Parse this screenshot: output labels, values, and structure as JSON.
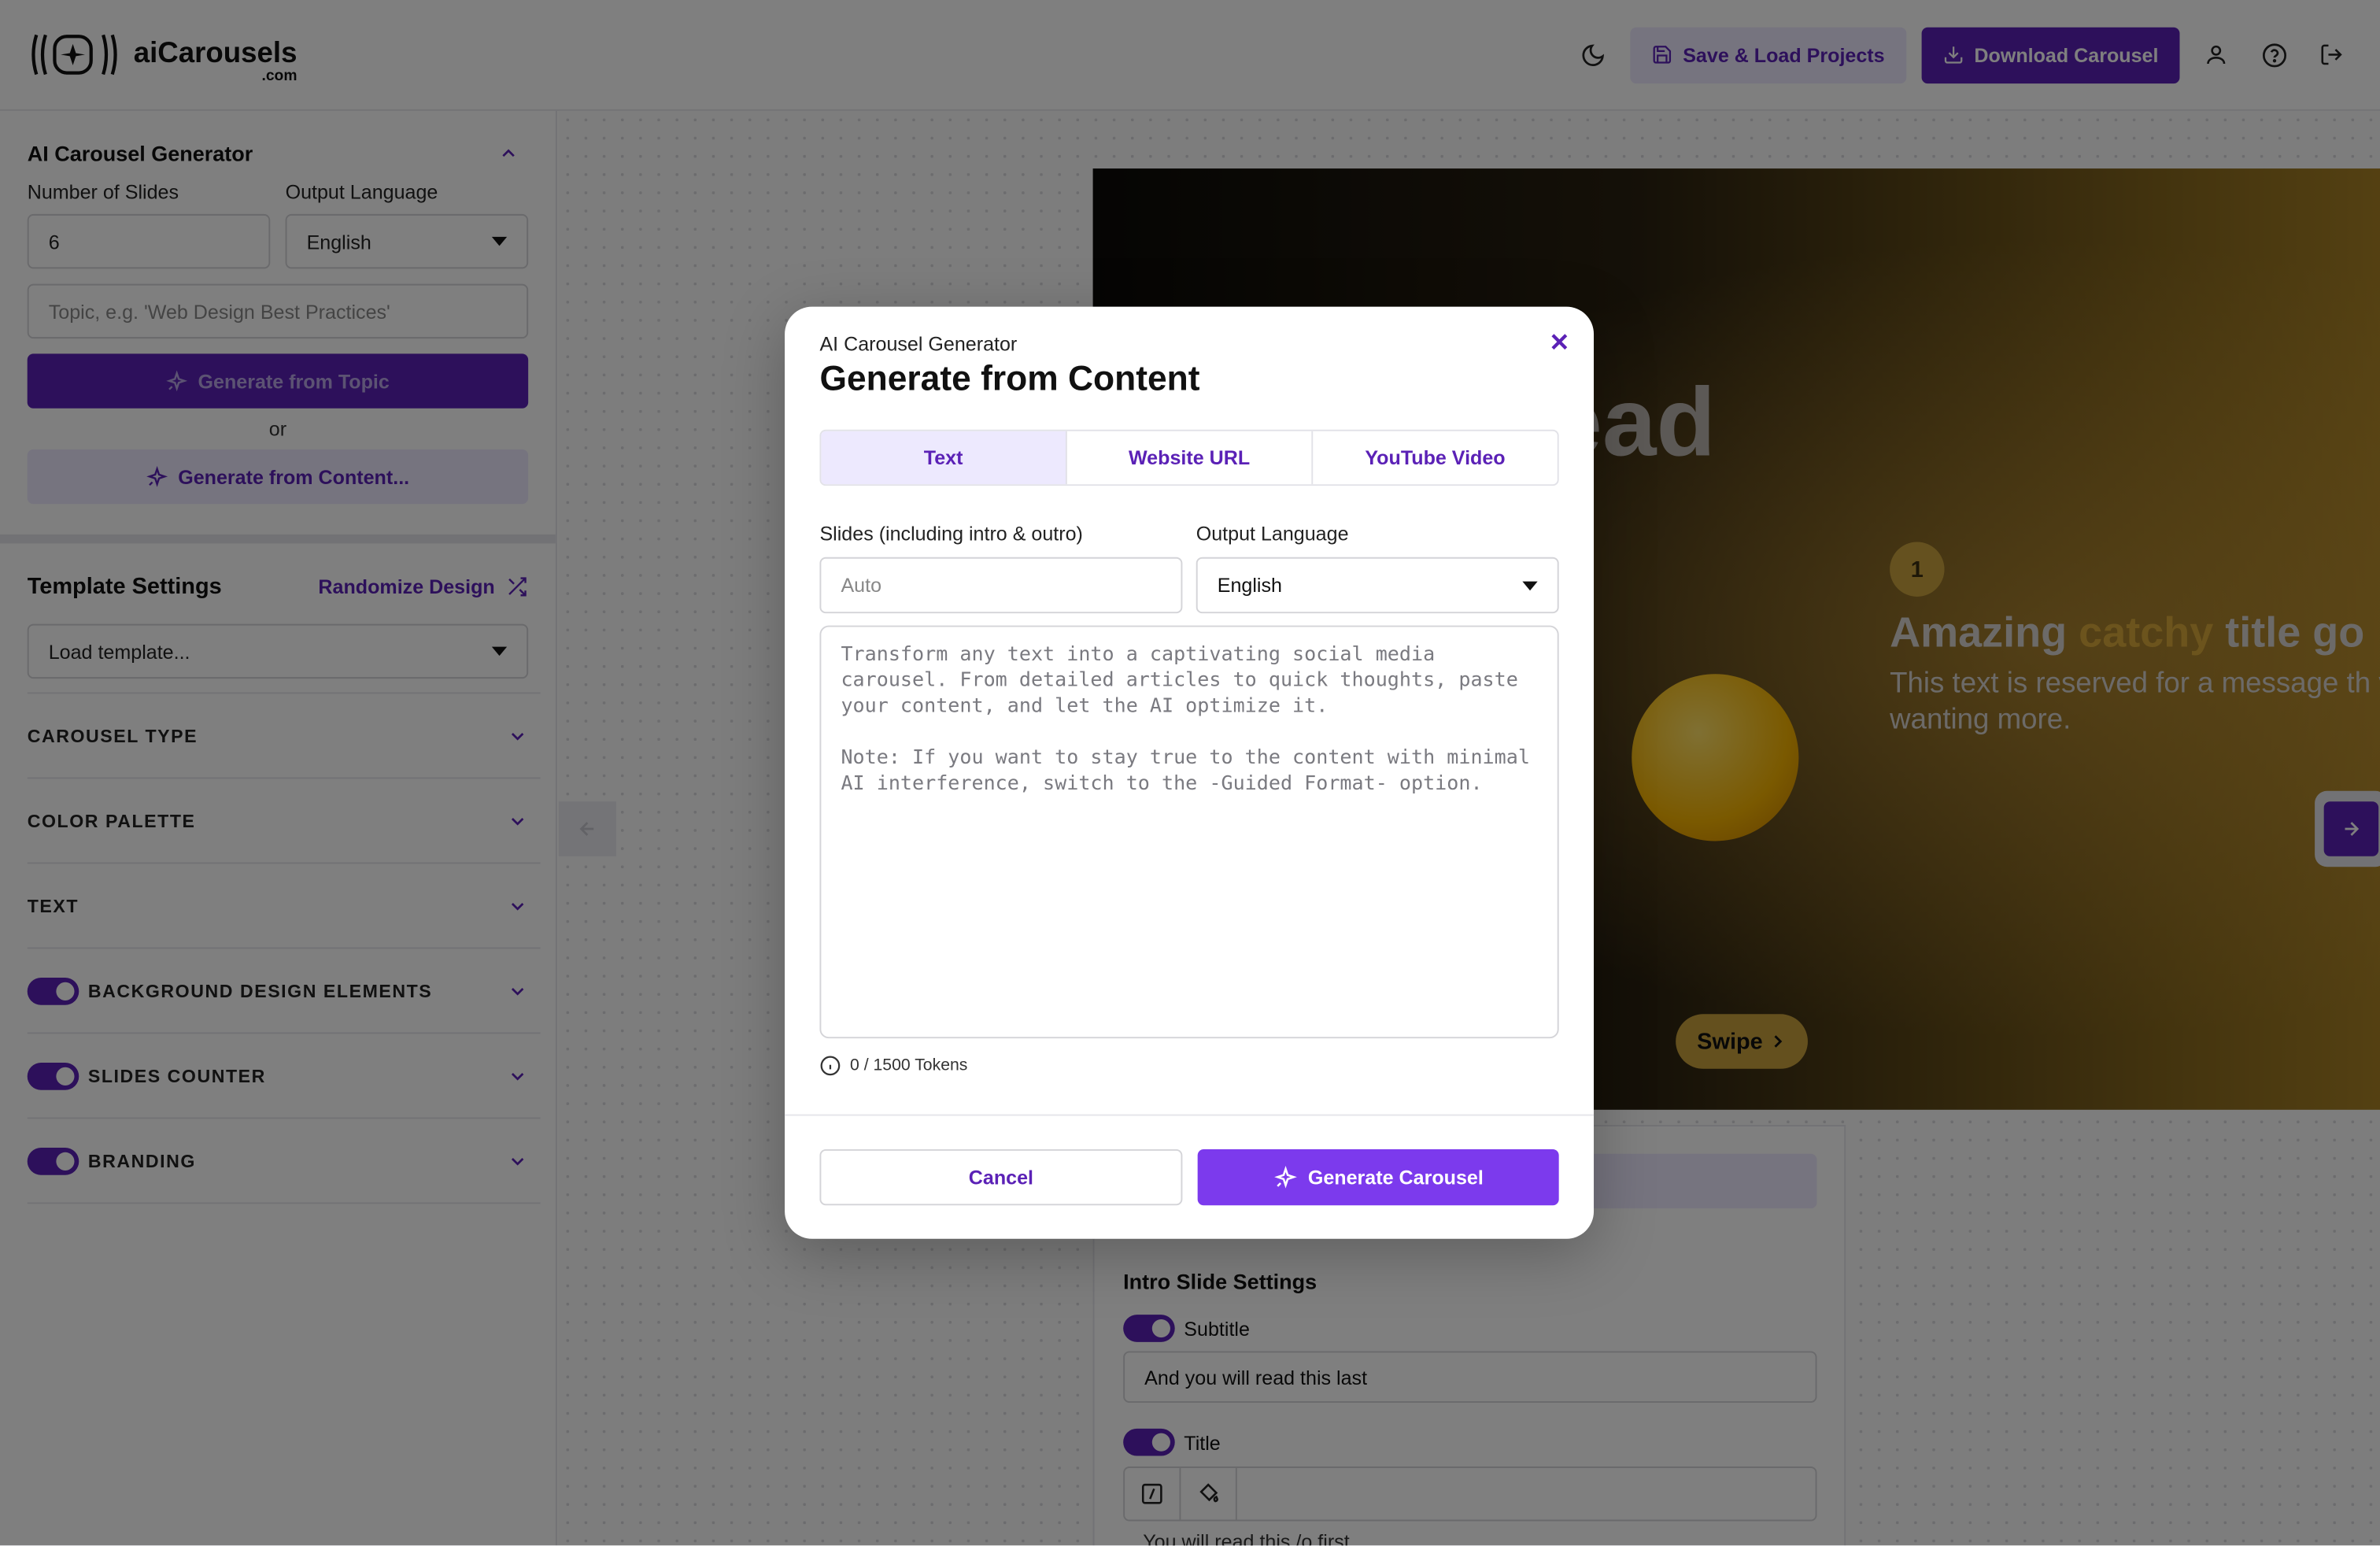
{
  "header": {
    "logo_text": "aiCarousels",
    "logo_sub": ".com",
    "save_label": "Save & Load Projects",
    "download_label": "Download  Carousel"
  },
  "sidebar": {
    "generator_title": "AI Carousel Generator",
    "slides_label": "Number of Slides",
    "slides_value": "6",
    "language_label": "Output Language",
    "language_value": "English",
    "topic_placeholder": "Topic, e.g. 'Web Design Best Practices'",
    "topic_button": "Generate from Topic",
    "or_text": "or",
    "content_button": "Generate from Content...",
    "template_title": "Template Settings",
    "randomize_label": "Randomize Design",
    "template_select": "Load template...",
    "accordions": [
      {
        "label": "CAROUSEL TYPE",
        "toggle": false
      },
      {
        "label": "COLOR PALETTE",
        "toggle": false
      },
      {
        "label": "TEXT",
        "toggle": false
      },
      {
        "label": "BACKGROUND DESIGN ELEMENTS",
        "toggle": true
      },
      {
        "label": "SLIDES COUNTER",
        "toggle": true
      },
      {
        "label": "BRANDING",
        "toggle": true
      }
    ]
  },
  "slide": {
    "big_word": "ead",
    "badge": "1",
    "title_a": "Amazing ",
    "title_accent": "catchy",
    "title_b": " title go",
    "body": "This text is reserved for a message th viewers wanting more.",
    "swipe": "Swipe"
  },
  "panel": {
    "title": "Intro Slide Settings",
    "subtitle_label": "Subtitle",
    "subtitle_value": "And you will read this last",
    "title_label": "Title",
    "title_value_cut": "You will read  this  /o  first"
  },
  "modal": {
    "kicker": "AI Carousel Generator",
    "title": "Generate from Content",
    "tabs": [
      "Text",
      "Website URL",
      "YouTube Video"
    ],
    "active_tab": "Text",
    "slides_label": "Slides (including intro & outro)",
    "slides_placeholder": "Auto",
    "language_label": "Output Language",
    "language_value": "English",
    "textarea_p1": "Transform any text into a captivating social media carousel. From detailed articles to quick thoughts, paste your content, and let the AI optimize it.",
    "textarea_p2": "Note: If you want to stay true to the content with minimal AI interference, switch to the -Guided Format- option.",
    "tokens": "0 / 1500 Tokens",
    "cancel": "Cancel",
    "generate": "Generate Carousel"
  },
  "colors": {
    "accent": "#5b21b6",
    "accent_light": "#ede9fe",
    "generate": "#7c3aed"
  }
}
